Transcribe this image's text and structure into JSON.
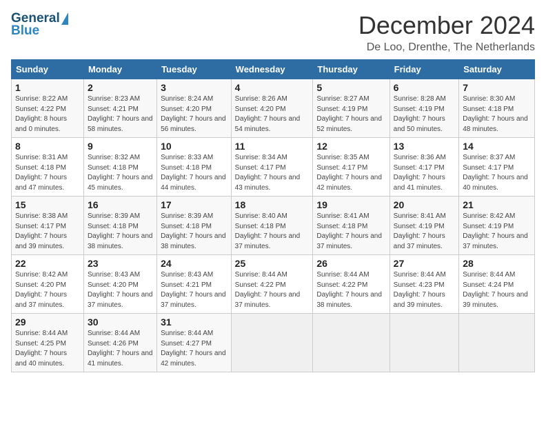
{
  "header": {
    "logo_general": "General",
    "logo_blue": "Blue",
    "month_title": "December 2024",
    "location": "De Loo, Drenthe, The Netherlands"
  },
  "days_of_week": [
    "Sunday",
    "Monday",
    "Tuesday",
    "Wednesday",
    "Thursday",
    "Friday",
    "Saturday"
  ],
  "weeks": [
    [
      {
        "num": "1",
        "sunrise": "8:22 AM",
        "sunset": "4:22 PM",
        "daylight": "8 hours and 0 minutes."
      },
      {
        "num": "2",
        "sunrise": "8:23 AM",
        "sunset": "4:21 PM",
        "daylight": "7 hours and 58 minutes."
      },
      {
        "num": "3",
        "sunrise": "8:24 AM",
        "sunset": "4:20 PM",
        "daylight": "7 hours and 56 minutes."
      },
      {
        "num": "4",
        "sunrise": "8:26 AM",
        "sunset": "4:20 PM",
        "daylight": "7 hours and 54 minutes."
      },
      {
        "num": "5",
        "sunrise": "8:27 AM",
        "sunset": "4:19 PM",
        "daylight": "7 hours and 52 minutes."
      },
      {
        "num": "6",
        "sunrise": "8:28 AM",
        "sunset": "4:19 PM",
        "daylight": "7 hours and 50 minutes."
      },
      {
        "num": "7",
        "sunrise": "8:30 AM",
        "sunset": "4:18 PM",
        "daylight": "7 hours and 48 minutes."
      }
    ],
    [
      {
        "num": "8",
        "sunrise": "8:31 AM",
        "sunset": "4:18 PM",
        "daylight": "7 hours and 47 minutes."
      },
      {
        "num": "9",
        "sunrise": "8:32 AM",
        "sunset": "4:18 PM",
        "daylight": "7 hours and 45 minutes."
      },
      {
        "num": "10",
        "sunrise": "8:33 AM",
        "sunset": "4:18 PM",
        "daylight": "7 hours and 44 minutes."
      },
      {
        "num": "11",
        "sunrise": "8:34 AM",
        "sunset": "4:17 PM",
        "daylight": "7 hours and 43 minutes."
      },
      {
        "num": "12",
        "sunrise": "8:35 AM",
        "sunset": "4:17 PM",
        "daylight": "7 hours and 42 minutes."
      },
      {
        "num": "13",
        "sunrise": "8:36 AM",
        "sunset": "4:17 PM",
        "daylight": "7 hours and 41 minutes."
      },
      {
        "num": "14",
        "sunrise": "8:37 AM",
        "sunset": "4:17 PM",
        "daylight": "7 hours and 40 minutes."
      }
    ],
    [
      {
        "num": "15",
        "sunrise": "8:38 AM",
        "sunset": "4:17 PM",
        "daylight": "7 hours and 39 minutes."
      },
      {
        "num": "16",
        "sunrise": "8:39 AM",
        "sunset": "4:18 PM",
        "daylight": "7 hours and 38 minutes."
      },
      {
        "num": "17",
        "sunrise": "8:39 AM",
        "sunset": "4:18 PM",
        "daylight": "7 hours and 38 minutes."
      },
      {
        "num": "18",
        "sunrise": "8:40 AM",
        "sunset": "4:18 PM",
        "daylight": "7 hours and 37 minutes."
      },
      {
        "num": "19",
        "sunrise": "8:41 AM",
        "sunset": "4:18 PM",
        "daylight": "7 hours and 37 minutes."
      },
      {
        "num": "20",
        "sunrise": "8:41 AM",
        "sunset": "4:19 PM",
        "daylight": "7 hours and 37 minutes."
      },
      {
        "num": "21",
        "sunrise": "8:42 AM",
        "sunset": "4:19 PM",
        "daylight": "7 hours and 37 minutes."
      }
    ],
    [
      {
        "num": "22",
        "sunrise": "8:42 AM",
        "sunset": "4:20 PM",
        "daylight": "7 hours and 37 minutes."
      },
      {
        "num": "23",
        "sunrise": "8:43 AM",
        "sunset": "4:20 PM",
        "daylight": "7 hours and 37 minutes."
      },
      {
        "num": "24",
        "sunrise": "8:43 AM",
        "sunset": "4:21 PM",
        "daylight": "7 hours and 37 minutes."
      },
      {
        "num": "25",
        "sunrise": "8:44 AM",
        "sunset": "4:22 PM",
        "daylight": "7 hours and 37 minutes."
      },
      {
        "num": "26",
        "sunrise": "8:44 AM",
        "sunset": "4:22 PM",
        "daylight": "7 hours and 38 minutes."
      },
      {
        "num": "27",
        "sunrise": "8:44 AM",
        "sunset": "4:23 PM",
        "daylight": "7 hours and 39 minutes."
      },
      {
        "num": "28",
        "sunrise": "8:44 AM",
        "sunset": "4:24 PM",
        "daylight": "7 hours and 39 minutes."
      }
    ],
    [
      {
        "num": "29",
        "sunrise": "8:44 AM",
        "sunset": "4:25 PM",
        "daylight": "7 hours and 40 minutes."
      },
      {
        "num": "30",
        "sunrise": "8:44 AM",
        "sunset": "4:26 PM",
        "daylight": "7 hours and 41 minutes."
      },
      {
        "num": "31",
        "sunrise": "8:44 AM",
        "sunset": "4:27 PM",
        "daylight": "7 hours and 42 minutes."
      },
      null,
      null,
      null,
      null
    ]
  ]
}
